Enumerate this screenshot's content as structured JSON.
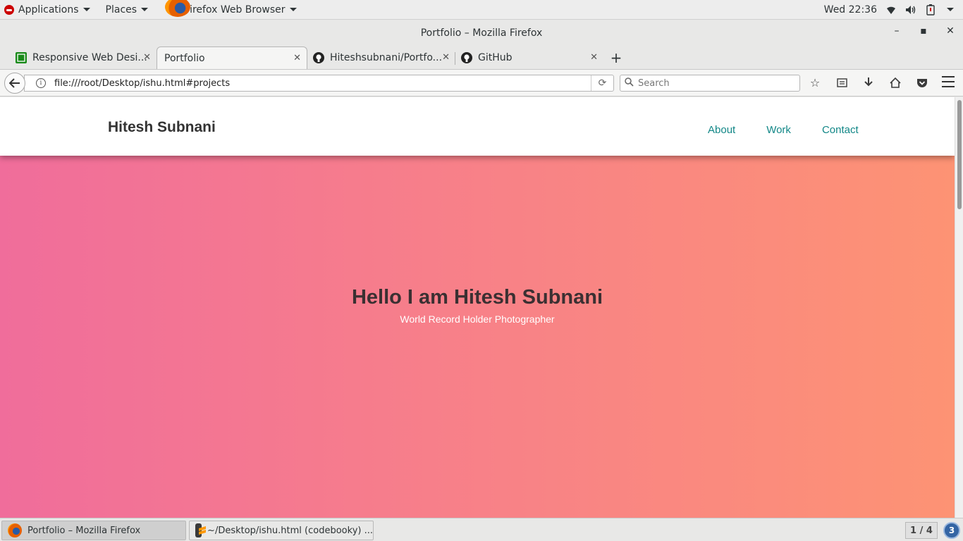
{
  "topbar": {
    "applications_label": "Applications",
    "places_label": "Places",
    "app_label": "Firefox Web Browser",
    "clock": "Wed 22:36"
  },
  "window": {
    "title": "Portfolio – Mozilla Firefox"
  },
  "tabs": [
    {
      "label": "Responsive Web Desi...",
      "icon": "green-site-favicon"
    },
    {
      "label": "Portfolio",
      "icon": "none"
    },
    {
      "label": "Hiteshsubnani/Portfo...",
      "icon": "github-icon"
    },
    {
      "label": "GitHub",
      "icon": "github-icon"
    }
  ],
  "navbar": {
    "url": "file:///root/Desktop/ishu.html#projects",
    "search_placeholder": "Search"
  },
  "page": {
    "brand": "Hitesh Subnani",
    "nav": [
      "About",
      "Work",
      "Contact"
    ],
    "hero_title": "Hello I am Hitesh Subnani",
    "hero_subtitle": "World Record Holder Photographer",
    "accent_color": "#128787",
    "gradient_colors": [
      "#f06d9b",
      "#fd9374"
    ]
  },
  "taskbar": {
    "tasks": [
      {
        "label": "Portfolio – Mozilla Firefox"
      },
      {
        "label": "~/Desktop/ishu.html (codebooky) ..."
      }
    ],
    "workspace": "1 / 4",
    "notifications": "3"
  }
}
